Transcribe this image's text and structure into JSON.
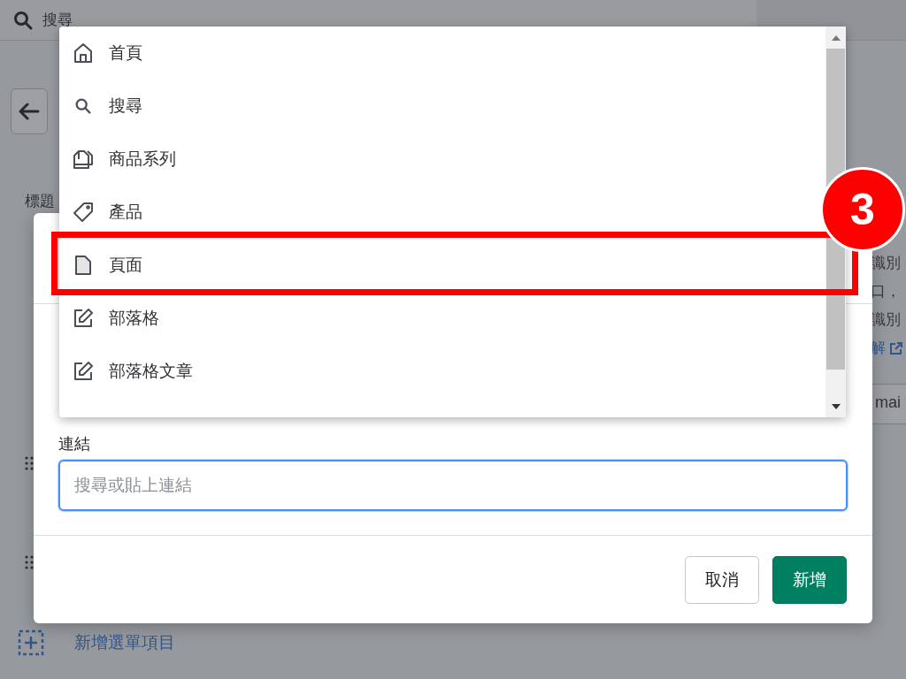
{
  "background_page": {
    "search_label": "搜尋",
    "title_label": "標題",
    "side_texts": [
      "識別",
      "口，",
      "識別",
      "解"
    ],
    "side_field_value": "mai",
    "add_item_link": "新增選單項目"
  },
  "dropdown": {
    "items": [
      {
        "label": "首頁",
        "kind": "home"
      },
      {
        "label": "搜尋",
        "kind": "search"
      },
      {
        "label": "商品系列",
        "kind": "collection"
      },
      {
        "label": "產品",
        "kind": "tag"
      },
      {
        "label": "頁面",
        "kind": "page"
      },
      {
        "label": "部落格",
        "kind": "edit"
      },
      {
        "label": "部落格文章",
        "kind": "edit"
      }
    ]
  },
  "modal": {
    "link_label": "連結",
    "link_field": {
      "placeholder": "搜尋或貼上連結"
    },
    "buttons": [
      {
        "label": "取消",
        "kind": "secondary"
      },
      {
        "label": "新增",
        "kind": "primary"
      }
    ]
  },
  "annotation": {
    "step": "3"
  }
}
